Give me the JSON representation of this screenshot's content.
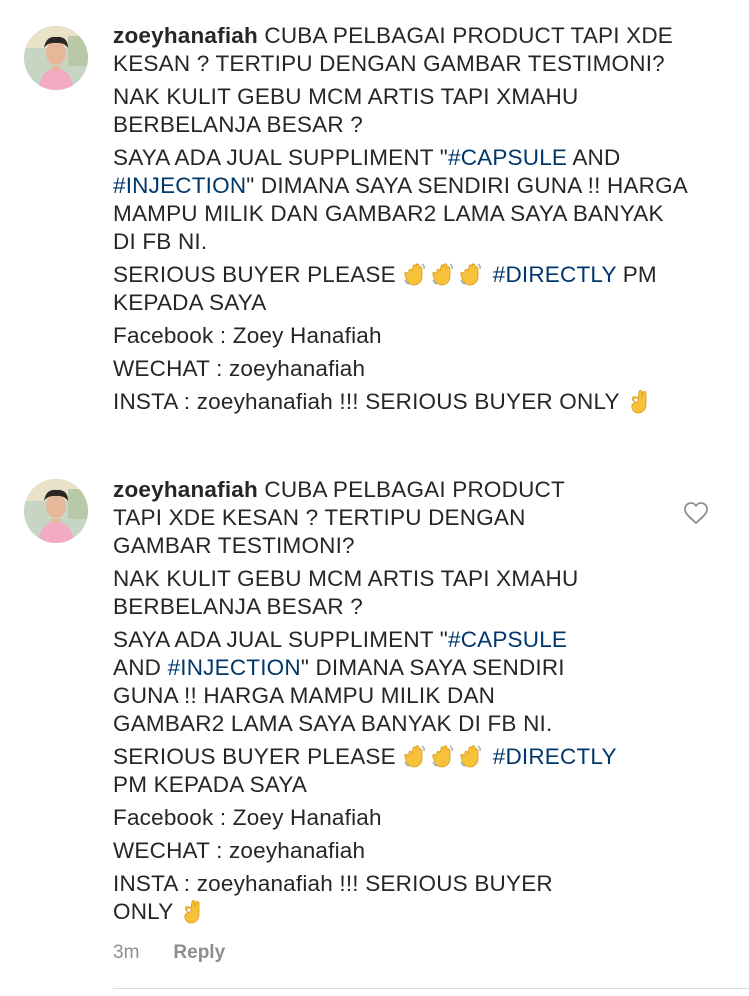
{
  "comments": [
    {
      "username": "zoeyhanafiah",
      "p1": " CUBA PELBAGAI PRODUCT TAPI XDE\nKESAN ? TERTIPU DENGAN GAMBAR TESTIMONI?",
      "p2": "NAK KULIT GEBU MCM ARTIS TAPI XMAHU\nBERBELANJA BESAR ?",
      "p3a": "SAYA ADA JUAL SUPPLIMENT \"",
      "tag_capsule": "#CAPSULE",
      "p3b": " AND\n",
      "tag_injection": "#INJECTION",
      "p3c": "\" DIMANA SAYA SENDIRI GUNA !! HARGA\nMAMPU MILIK DAN GAMBAR2 LAMA SAYA BANYAK\nDI FB NI.",
      "p4a": "SERIOUS BUYER PLEASE ",
      "tag_directly": "#DIRECTLY",
      "p4b": " PM\nKEPADA SAYA",
      "p5": "Facebook : Zoey Hanafiah",
      "p6": "WECHAT : zoeyhanafiah",
      "p7": "INSTA : zoeyhanafiah !!! SERIOUS BUYER ONLY "
    },
    {
      "username": "zoeyhanafiah",
      "p1": " CUBA PELBAGAI PRODUCT\nTAPI XDE KESAN ? TERTIPU DENGAN\nGAMBAR TESTIMONI?",
      "p2": "NAK KULIT GEBU MCM ARTIS TAPI XMAHU\nBERBELANJA BESAR ?",
      "p3a": "SAYA ADA JUAL SUPPLIMENT \"",
      "tag_capsule": "#CAPSULE",
      "p3b": "\nAND ",
      "tag_injection": "#INJECTION",
      "p3c": "\" DIMANA SAYA SENDIRI\nGUNA !! HARGA MAMPU MILIK DAN\nGAMBAR2 LAMA SAYA BANYAK DI FB NI.",
      "p4a": "SERIOUS BUYER PLEASE ",
      "tag_directly": "#DIRECTLY",
      "p4b": "\nPM KEPADA SAYA",
      "p5": "Facebook : Zoey Hanafiah",
      "p6": "WECHAT : zoeyhanafiah",
      "p7": "INSTA : zoeyhanafiah !!! SERIOUS BUYER\nONLY ",
      "time": "3m",
      "reply_label": "Reply"
    }
  ],
  "icons": {
    "wave": "waving-hand-emoji",
    "ok": "ok-hand-emoji",
    "heart": "heart-outline-icon"
  },
  "colors": {
    "hashtag": "#00376b",
    "meta": "#8e8e8e",
    "text": "#262626"
  }
}
